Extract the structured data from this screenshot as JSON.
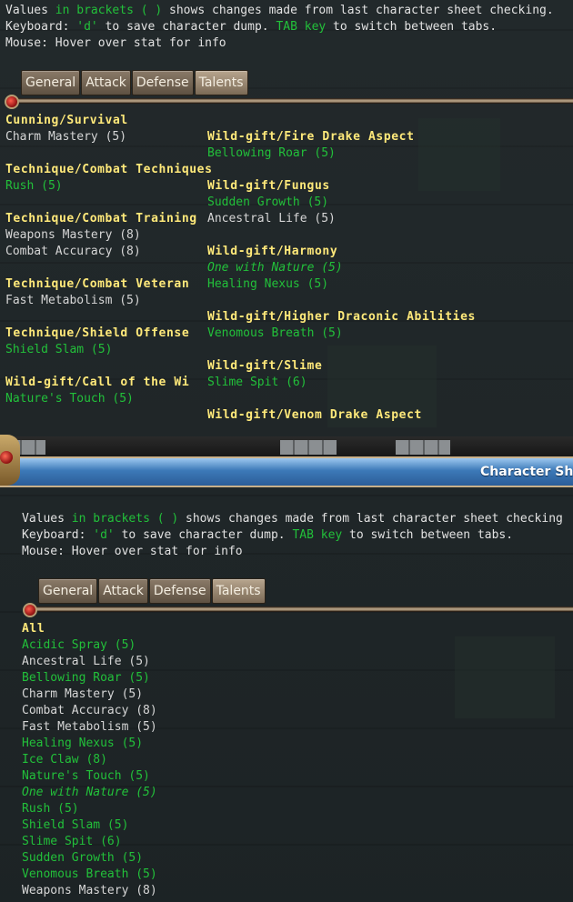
{
  "info": {
    "line1_pre": "Values ",
    "line1_hl": "in brackets ( )",
    "line1_post": " shows changes made from last character sheet checking.",
    "line2_pre": "Keyboard: ",
    "line2_key": "'d'",
    "line2_mid": " to save character dump. ",
    "line2_tab": "TAB key",
    "line2_post": " to switch between tabs.",
    "line3": "Mouse: Hover over stat for info"
  },
  "info2": {
    "line1_post": " shows changes made from last character sheet checking"
  },
  "tabs": [
    "General",
    "Attack",
    "Defense",
    "Talents"
  ],
  "active_tab": "Talents",
  "window_title": "Character Sh",
  "left_column": [
    {
      "header": "Cunning/Survival",
      "talents": [
        {
          "name": "Charm Mastery (5)",
          "style": "white"
        }
      ]
    },
    {
      "header": "Technique/Combat Techniques",
      "talents": [
        {
          "name": "Rush (5)",
          "style": "green"
        }
      ]
    },
    {
      "header": "Technique/Combat Training",
      "talents": [
        {
          "name": "Weapons Mastery (8)",
          "style": "white"
        },
        {
          "name": "Combat Accuracy (8)",
          "style": "white"
        }
      ]
    },
    {
      "header": "Technique/Combat Veteran",
      "talents": [
        {
          "name": "Fast Metabolism (5)",
          "style": "white"
        }
      ]
    },
    {
      "header": "Technique/Shield Offense",
      "talents": [
        {
          "name": "Shield Slam (5)",
          "style": "green"
        }
      ]
    },
    {
      "header": "Wild-gift/Call of the Wi",
      "talents": [
        {
          "name": "Nature's Touch (5)",
          "style": "green"
        }
      ]
    }
  ],
  "right_column": [
    {
      "header": "Wild-gift/Fire Drake Aspect",
      "talents": [
        {
          "name": "Bellowing Roar (5)",
          "style": "green"
        }
      ]
    },
    {
      "header": "Wild-gift/Fungus",
      "talents": [
        {
          "name": "Sudden Growth (5)",
          "style": "green"
        },
        {
          "name": "Ancestral Life (5)",
          "style": "white"
        }
      ]
    },
    {
      "header": "Wild-gift/Harmony",
      "talents": [
        {
          "name": "One with Nature (5)",
          "style": "greenit"
        },
        {
          "name": "Healing Nexus (5)",
          "style": "green"
        }
      ]
    },
    {
      "header": "Wild-gift/Higher Draconic Abilities",
      "talents": [
        {
          "name": "Venomous Breath (5)",
          "style": "green"
        }
      ]
    },
    {
      "header": "Wild-gift/Slime",
      "talents": [
        {
          "name": "Slime Spit (6)",
          "style": "green"
        }
      ]
    },
    {
      "header": "Wild-gift/Venom Drake Aspect",
      "talents": []
    }
  ],
  "all_list": {
    "header": "All",
    "talents": [
      {
        "name": "Acidic Spray (5)",
        "style": "green"
      },
      {
        "name": "Ancestral Life (5)",
        "style": "white"
      },
      {
        "name": "Bellowing Roar (5)",
        "style": "green"
      },
      {
        "name": "Charm Mastery (5)",
        "style": "white"
      },
      {
        "name": "Combat Accuracy (8)",
        "style": "white"
      },
      {
        "name": "Fast Metabolism (5)",
        "style": "white"
      },
      {
        "name": "Healing Nexus (5)",
        "style": "green"
      },
      {
        "name": "Ice Claw (8)",
        "style": "green"
      },
      {
        "name": "Nature's Touch (5)",
        "style": "green"
      },
      {
        "name": "One with Nature (5)",
        "style": "greenit"
      },
      {
        "name": "Rush (5)",
        "style": "green"
      },
      {
        "name": "Shield Slam (5)",
        "style": "green"
      },
      {
        "name": "Slime Spit (6)",
        "style": "green"
      },
      {
        "name": "Sudden Growth (5)",
        "style": "green"
      },
      {
        "name": "Venomous Breath (5)",
        "style": "green"
      },
      {
        "name": "Weapons Mastery (8)",
        "style": "white"
      }
    ]
  },
  "colors": {
    "header": "#ffe97a",
    "green": "#22c03a",
    "white": "#d6d6d6",
    "title_bar": "#3c79b8"
  }
}
